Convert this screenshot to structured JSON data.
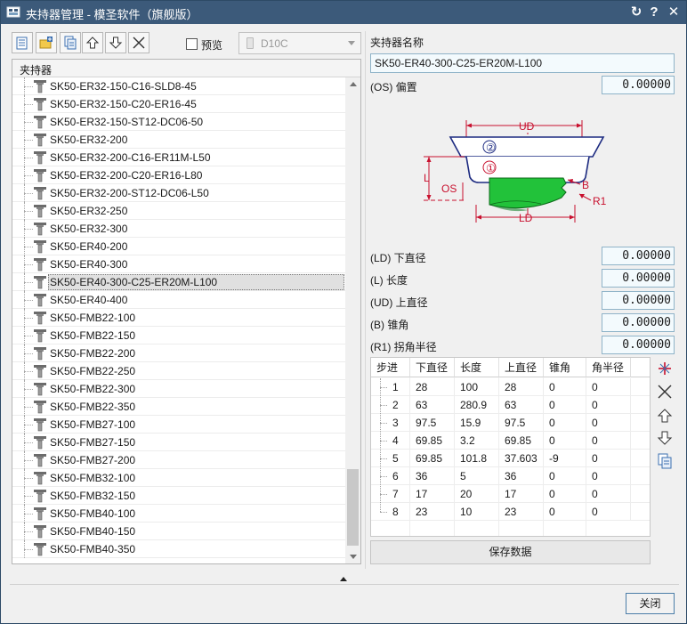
{
  "window": {
    "title": "夹持器管理 - 模圣软件（旗舰版）",
    "buttons": {
      "refresh": "↻",
      "help": "?",
      "close": "✕"
    }
  },
  "toolbar": {
    "preview_label": "预览",
    "preview_checked": false,
    "tool_combo_value": "D10C"
  },
  "tree": {
    "header": "夹持器",
    "items": [
      "SK50-ER32-150-C16-SLD8-45",
      "SK50-ER32-150-C20-ER16-45",
      "SK50-ER32-150-ST12-DC06-50",
      "SK50-ER32-200",
      "SK50-ER32-200-C16-ER11M-L50",
      "SK50-ER32-200-C20-ER16-L80",
      "SK50-ER32-200-ST12-DC06-L50",
      "SK50-ER32-250",
      "SK50-ER32-300",
      "SK50-ER40-200",
      "SK50-ER40-300",
      "SK50-ER40-300-C25-ER20M-L100",
      "SK50-ER40-400",
      "SK50-FMB22-100",
      "SK50-FMB22-150",
      "SK50-FMB22-200",
      "SK50-FMB22-250",
      "SK50-FMB22-300",
      "SK50-FMB22-350",
      "SK50-FMB27-100",
      "SK50-FMB27-150",
      "SK50-FMB27-200",
      "SK50-FMB32-100",
      "SK50-FMB32-150",
      "SK50-FMB40-100",
      "SK50-FMB40-150",
      "SK50-FMB40-350"
    ],
    "selected": "SK50-ER40-300-C25-ER20M-L100"
  },
  "details": {
    "name_label": "夹持器名称",
    "name_value": "SK50-ER40-300-C25-ER20M-L100",
    "os_label": "(OS) 偏置",
    "os_value": "0.00000",
    "ld_label": "(LD) 下直径",
    "ld_value": "0.00000",
    "l_label": "(L) 长度",
    "l_value": "0.00000",
    "ud_label": "(UD) 上直径",
    "ud_value": "0.00000",
    "b_label": "(B) 锥角",
    "b_value": "0.00000",
    "r1_label": "(R1) 拐角半径",
    "r1_value": "0.00000"
  },
  "diagram": {
    "labels": {
      "ud": "UD",
      "ld": "LD",
      "l": "L",
      "os": "OS",
      "b": "B",
      "r1": "R1",
      "step1": "①",
      "step2": "②"
    }
  },
  "steps_table": {
    "headers": [
      "步进",
      "下直径",
      "长度",
      "上直径",
      "锥角",
      "角半径"
    ],
    "rows": [
      [
        "1",
        "28",
        "100",
        "28",
        "0",
        "0"
      ],
      [
        "2",
        "63",
        "280.9",
        "63",
        "0",
        "0"
      ],
      [
        "3",
        "97.5",
        "15.9",
        "97.5",
        "0",
        "0"
      ],
      [
        "4",
        "69.85",
        "3.2",
        "69.85",
        "0",
        "0"
      ],
      [
        "5",
        "69.85",
        "101.8",
        "37.603",
        "-9",
        "0"
      ],
      [
        "6",
        "36",
        "5",
        "36",
        "0",
        "0"
      ],
      [
        "7",
        "17",
        "20",
        "17",
        "0",
        "0"
      ],
      [
        "8",
        "23",
        "10",
        "23",
        "0",
        "0"
      ]
    ]
  },
  "actions": {
    "save_label": "保存数据",
    "close_label": "关闭"
  },
  "colors": {
    "titlebar": "#3c5a7a",
    "diagram_red": "#c8102e",
    "diagram_navy": "#1c2a80",
    "diagram_green": "#22c23a"
  }
}
